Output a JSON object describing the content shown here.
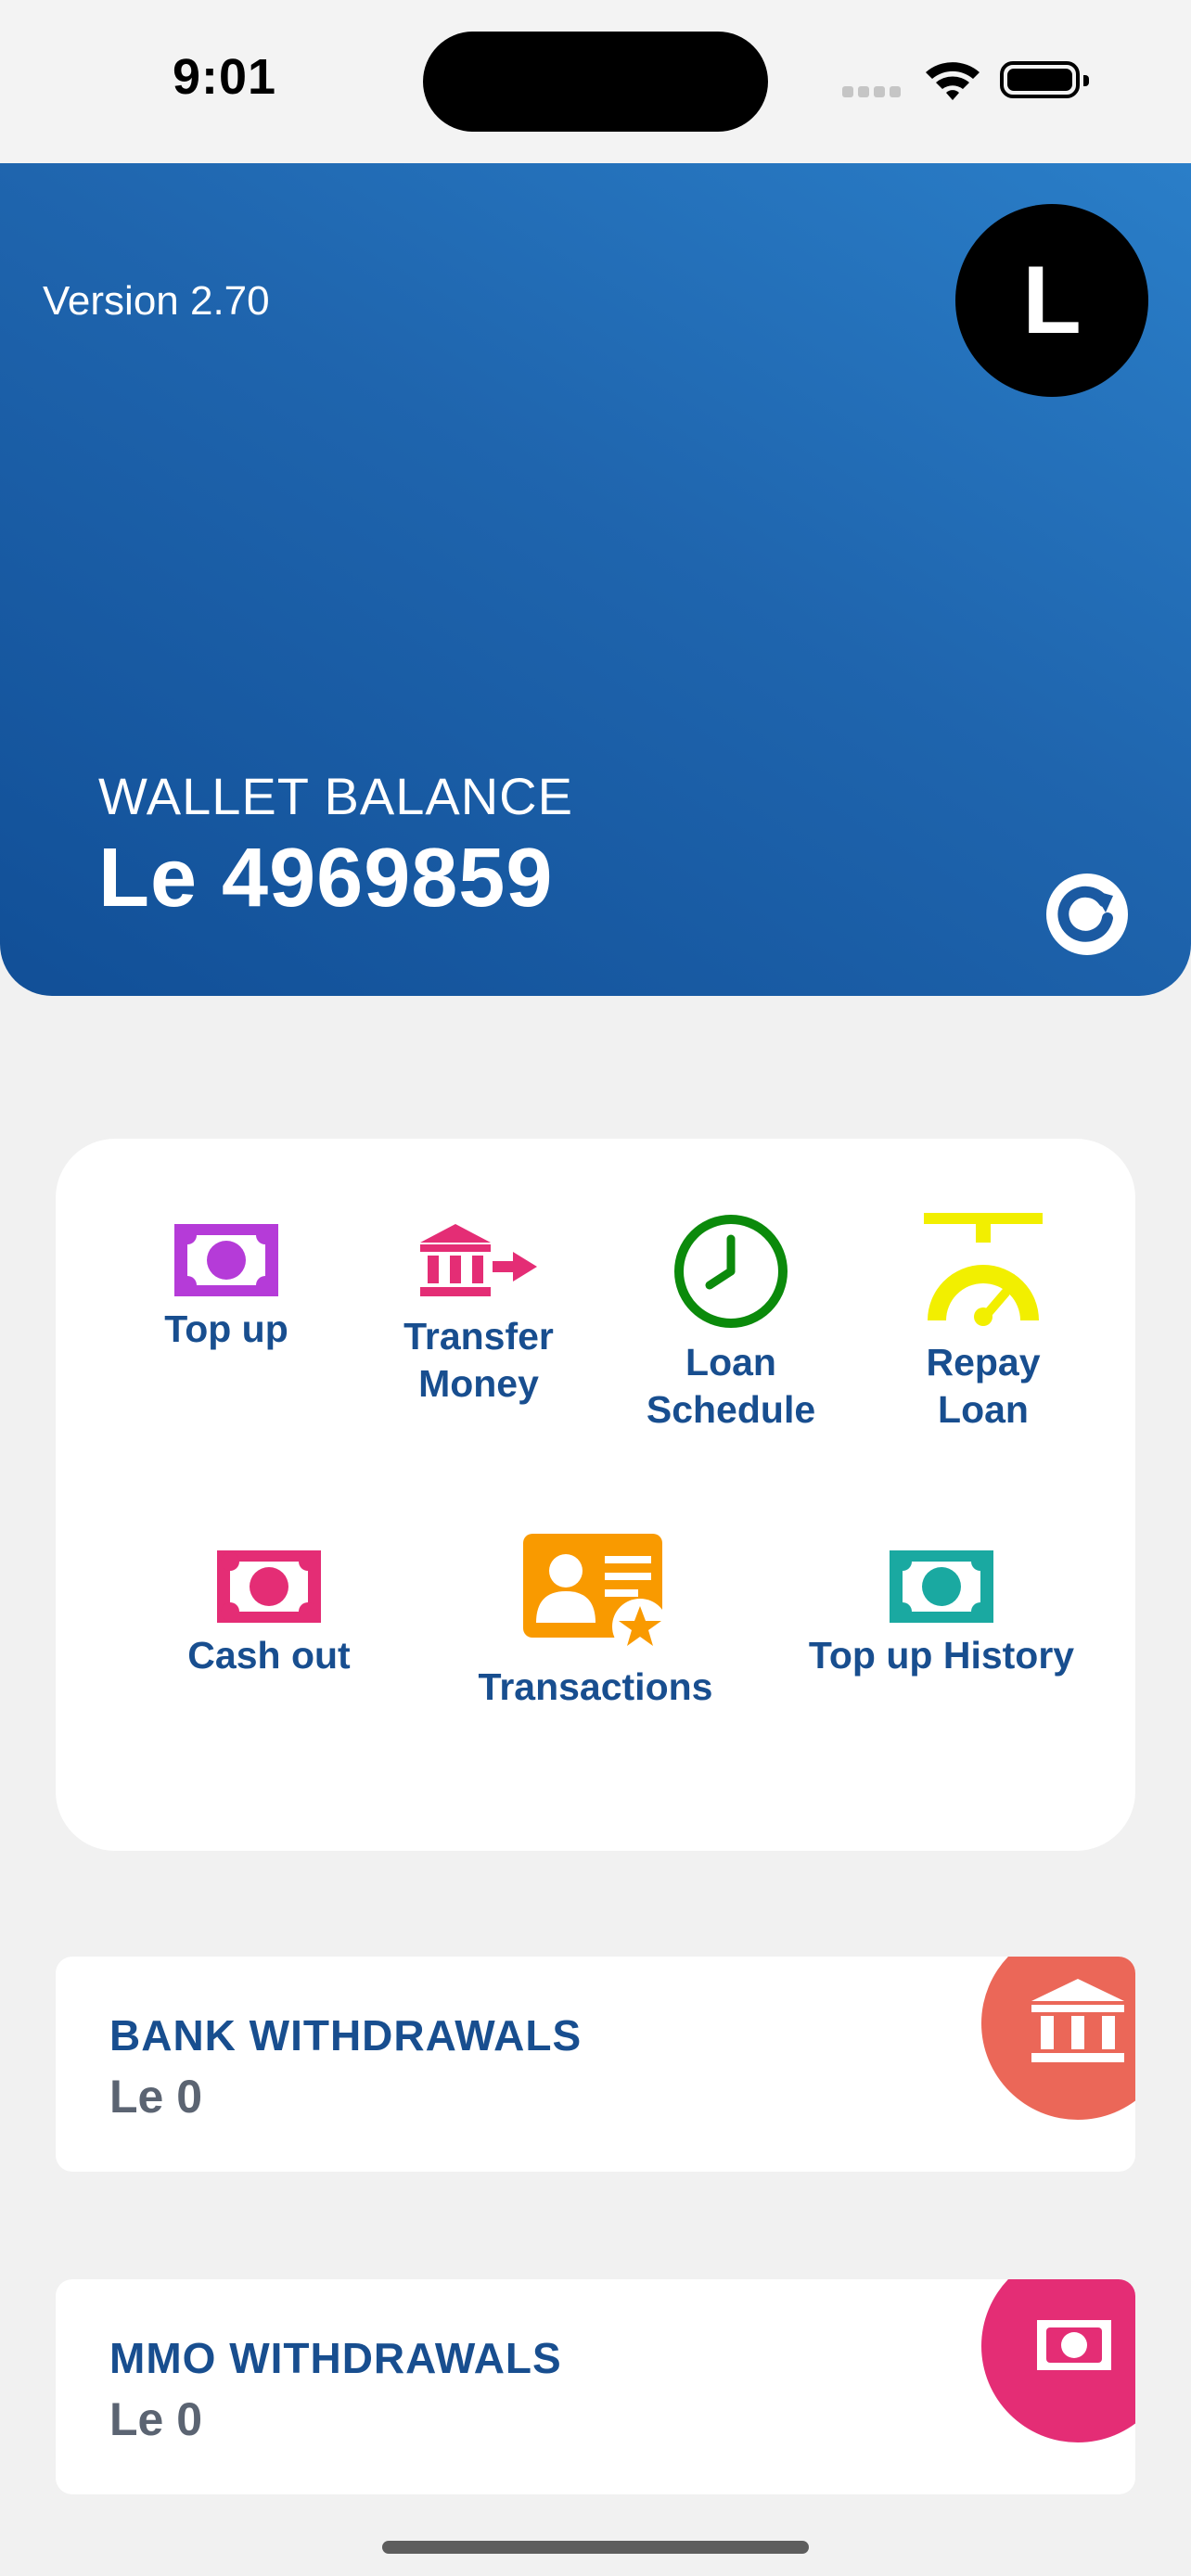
{
  "status_bar": {
    "time": "9:01"
  },
  "header": {
    "version": "Version 2.70",
    "avatar_initial": "L",
    "wallet_label": "WALLET BALANCE",
    "wallet_value": "Le 4969859",
    "gradient_colors": [
      "#2a7ec8",
      "#114f97"
    ]
  },
  "actions": [
    {
      "id": "top-up",
      "label": "Top up",
      "icon": "money-icon",
      "color": "#b53bd8"
    },
    {
      "id": "transfer-money",
      "label": "Transfer\nMoney",
      "icon": "bank-transfer-icon",
      "color": "#e42d75"
    },
    {
      "id": "loan-schedule",
      "label": "Loan\nSchedule",
      "icon": "clock-icon",
      "color": "#0b8a0b"
    },
    {
      "id": "repay-loan",
      "label": "Repay\nLoan",
      "icon": "gauge-icon",
      "color": "#f2ef00"
    },
    {
      "id": "cash-out",
      "label": "Cash out",
      "icon": "money-icon",
      "color": "#e42d75"
    },
    {
      "id": "transactions",
      "label": "Transactions",
      "icon": "contact-card-icon",
      "color": "#f99a00"
    },
    {
      "id": "top-up-history",
      "label": "Top up History",
      "icon": "money-icon",
      "color": "#1aa9a1"
    }
  ],
  "cards": [
    {
      "title": "BANK WITHDRAWALS",
      "amount": "Le 0",
      "icon": "bank-icon",
      "color": "#eb6758"
    },
    {
      "title": "MMO WITHDRAWALS",
      "amount": "Le 0",
      "icon": "money-icon",
      "color": "#e42d75"
    }
  ]
}
